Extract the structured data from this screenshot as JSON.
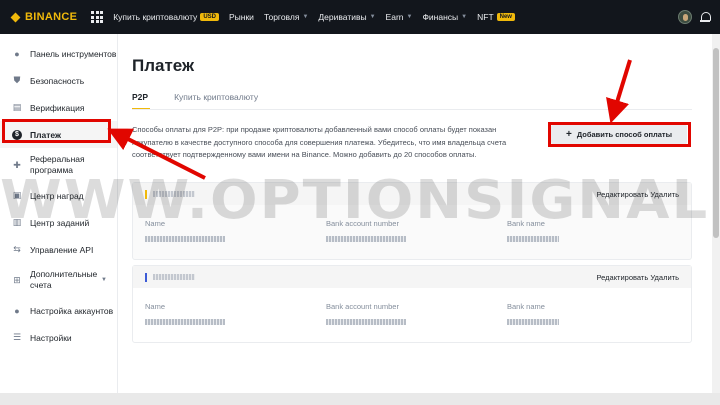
{
  "topbar": {
    "logo": "BINANCE",
    "nav": [
      {
        "label": "Купить криптовалюту",
        "badge": "USD",
        "caret": false
      },
      {
        "label": "Рынки",
        "badge": "",
        "caret": false
      },
      {
        "label": "Торговля",
        "badge": "",
        "caret": true
      },
      {
        "label": "Деривативы",
        "badge": "",
        "caret": true
      },
      {
        "label": "Earn",
        "badge": "",
        "caret": true
      },
      {
        "label": "Финансы",
        "badge": "",
        "caret": true
      },
      {
        "label": "NFT",
        "badge": "New",
        "caret": false
      }
    ]
  },
  "sidebar": {
    "items": [
      {
        "label": "Панель инструментов",
        "icon": "user-icon"
      },
      {
        "label": "Безопасность",
        "icon": "shield-icon"
      },
      {
        "label": "Верификация",
        "icon": "id-card-icon"
      },
      {
        "label": "Платеж",
        "icon": "dollar-icon"
      },
      {
        "label": "Реферальная программа",
        "icon": "user-plus-icon"
      },
      {
        "label": "Центр наград",
        "icon": "ticket-icon"
      },
      {
        "label": "Центр заданий",
        "icon": "task-icon"
      },
      {
        "label": "Управление API",
        "icon": "api-icon"
      },
      {
        "label": "Дополнительные счета",
        "icon": "sub-account-icon"
      },
      {
        "label": "Настройка аккаунтов",
        "icon": "users-icon"
      },
      {
        "label": "Настройки",
        "icon": "sliders-icon"
      }
    ]
  },
  "main": {
    "title": "Платеж",
    "tabs": [
      "P2P",
      "Купить криптовалюту"
    ],
    "description": "Способы оплаты для P2P: при продаже криптовалюты добавленный вами способ оплаты будет показан покупателю в качестве доступного способа для совершения платежа. Убедитесь, что имя владельца счета соответствует подтвержденному вами имени на Binance. Можно добавить до 20 способов оплаты.",
    "add_button": "Добавить способ оплаты",
    "cards": [
      {
        "actions": "Редактировать Удалить",
        "fields": [
          "Name",
          "Bank account number",
          "Bank name"
        ],
        "mark_color": "#f0b90b"
      },
      {
        "actions": "Редактировать Удалить",
        "fields": [
          "Name",
          "Bank account number",
          "Bank name"
        ],
        "mark_color": "#3c5bd6"
      }
    ]
  },
  "watermark": "WWW.OPTIONSIGNALS.COM",
  "colors": {
    "accent": "#f0b90b",
    "highlight": "#e10600",
    "topbar": "#12161c"
  }
}
